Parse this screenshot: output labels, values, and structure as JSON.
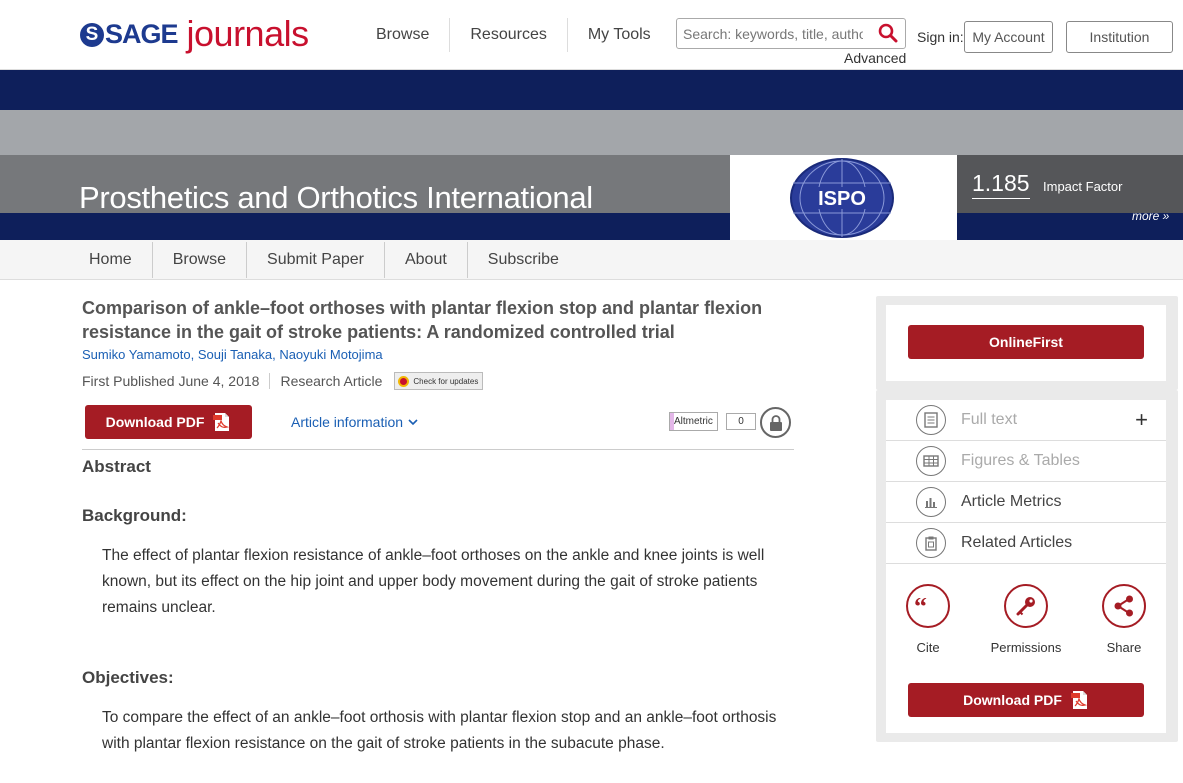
{
  "header": {
    "logo_s": "S",
    "logo_sage": "SAGE",
    "logo_journals": "journals",
    "nav": [
      "Browse",
      "Resources",
      "My Tools"
    ],
    "search_placeholder": "Search: keywords, title, autho",
    "advanced": "Advanced",
    "signin": "Sign in:",
    "my_account": "My Account",
    "institution": "Institution"
  },
  "banner": {
    "journal_title": "Prosthetics and Orthotics International",
    "logo_text": "ISPO",
    "impact_value": "1.185",
    "impact_label": "Impact Factor",
    "more": "more »"
  },
  "journal_nav": [
    "Home",
    "Browse",
    "Submit Paper",
    "About",
    "Subscribe"
  ],
  "article": {
    "title": "Comparison of ankle–foot orthoses with plantar flexion stop and plantar flexion resistance in the gait of stroke patients: A randomized controlled trial",
    "authors": [
      "Sumiko Yamamoto",
      "Souji Tanaka",
      "Naoyuki Motojima"
    ],
    "published": "First Published June 4, 2018",
    "type": "Research Article",
    "check_updates": "Check for updates",
    "download_pdf": "Download PDF",
    "article_info": "Article information",
    "altmetric": "Altmetric",
    "altmetric_count": "0",
    "abstract_heading": "Abstract",
    "sections": [
      {
        "heading": "Background:",
        "text": "The effect of plantar flexion resistance of ankle–foot orthoses on the ankle and knee joints is well known, but its effect on the hip joint and upper body movement during the gait of stroke patients remains unclear."
      },
      {
        "heading": "Objectives:",
        "text": "To compare the effect of an ankle–foot orthosis with plantar flexion stop and an ankle–foot orthosis with plantar flexion resistance on the gait of stroke patients in the subacute phase."
      }
    ]
  },
  "sidebar": {
    "online_first": "OnlineFirst",
    "menu": [
      {
        "label": "Full text",
        "icon": "document-icon",
        "enabled": false,
        "expand": "+"
      },
      {
        "label": "Figures & Tables",
        "icon": "table-icon",
        "enabled": false
      },
      {
        "label": "Article Metrics",
        "icon": "bar-chart-icon",
        "enabled": true
      },
      {
        "label": "Related Articles",
        "icon": "clipboard-icon",
        "enabled": true
      }
    ],
    "tools": [
      {
        "label": "Cite",
        "icon": "quote-icon"
      },
      {
        "label": "Permissions",
        "icon": "key-icon"
      },
      {
        "label": "Share",
        "icon": "share-icon"
      }
    ],
    "download_pdf": "Download PDF"
  },
  "colors": {
    "brand_blue": "#1d3a8f",
    "brand_red": "#c8102e",
    "button_red": "#a51c24",
    "navy_band": "#0e1f5b",
    "link_blue": "#1a5fb4"
  }
}
